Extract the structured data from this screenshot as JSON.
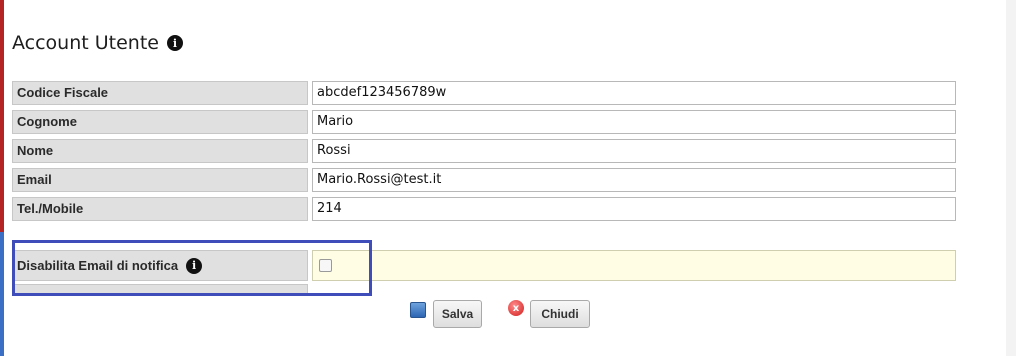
{
  "page": {
    "title": "Account Utente",
    "info_glyph": "i"
  },
  "fields": [
    {
      "label": "Codice Fiscale",
      "value": "abcdef123456789w"
    },
    {
      "label": "Cognome",
      "value": "Mario"
    },
    {
      "label": "Nome",
      "value": "Rossi"
    },
    {
      "label": "Email",
      "value": "Mario.Rossi@test.it"
    },
    {
      "label": "Tel./Mobile",
      "value": "214"
    }
  ],
  "notification": {
    "label": "Disabilita Email di notifica",
    "checked": false
  },
  "buttons": {
    "save_label": "Salva",
    "close_label": "Chiudi",
    "close_glyph": "x"
  },
  "colors": {
    "highlight_border": "#3f4dbb",
    "notify_bg": "#fffde3"
  }
}
